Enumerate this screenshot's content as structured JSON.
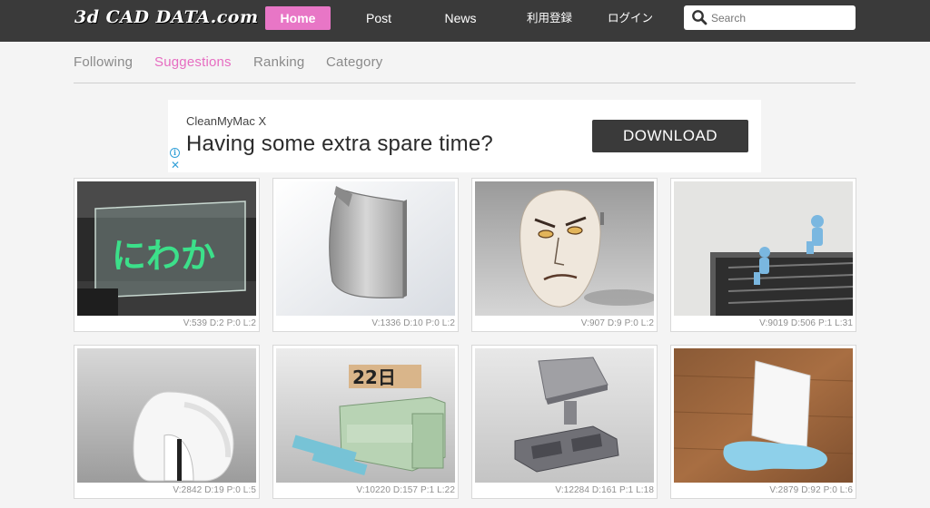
{
  "header": {
    "logo": "3d CAD DATA.com",
    "nav": {
      "home": "Home",
      "post": "Post",
      "news": "News",
      "register": "利用登録",
      "login": "ログイン"
    },
    "search": {
      "placeholder": "Search",
      "value": ""
    }
  },
  "tabs": {
    "following": "Following",
    "suggestions": "Suggestions",
    "ranking": "Ranking",
    "category": "Category",
    "active": "suggestions"
  },
  "ad": {
    "brand": "CleanMyMac X",
    "headline": "Having some extra spare time?",
    "button": "DOWNLOAD",
    "info_icon": "info-icon",
    "close_icon": "close-icon"
  },
  "cards": [
    {
      "stats": "V:539 D:2 P:0 L:2",
      "glyph_text": "にわか"
    },
    {
      "stats": "V:1336 D:10 P:0 L:2"
    },
    {
      "stats": "V:907 D:9 P:0 L:2"
    },
    {
      "stats": "V:9019 D:506 P:1 L:31"
    },
    {
      "stats": "V:2842 D:19 P:0 L:5"
    },
    {
      "stats": "V:10220 D:157 P:1 L:22",
      "glyph_text": "22日"
    },
    {
      "stats": "V:12284 D:161 P:1 L:18"
    },
    {
      "stats": "V:2879 D:92 P:0 L:6"
    }
  ],
  "colors": {
    "topbar": "#3a3a3a",
    "accent_pink": "#e876c6",
    "active_tab": "#e66dc1",
    "ad_button": "#3a3a3a"
  }
}
